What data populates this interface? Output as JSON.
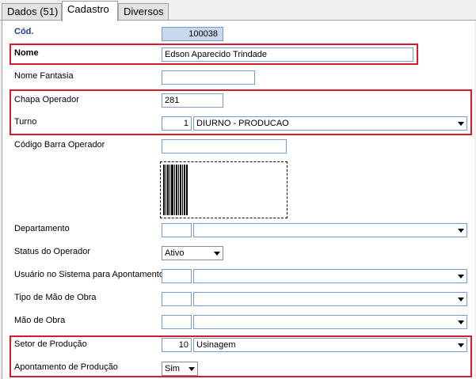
{
  "tabs": [
    {
      "label": "Dados (51)",
      "active": false
    },
    {
      "label": "Cadastro",
      "active": true
    },
    {
      "label": "Diversos",
      "active": false
    }
  ],
  "form": {
    "cod": {
      "label": "Cód.",
      "value": "100038"
    },
    "nome": {
      "label": "Nome",
      "value": "Edson Aparecido Trindade"
    },
    "nome_fantasia": {
      "label": "Nome Fantasia",
      "value": ""
    },
    "chapa_operador": {
      "label": "Chapa Operador",
      "value": "281"
    },
    "turno": {
      "label": "Turno",
      "code": "1",
      "value": "DIURNO - PRODUCAO"
    },
    "codigo_barra": {
      "label": "Código Barra Operador",
      "value": ""
    },
    "departamento": {
      "label": "Departamento",
      "code": "",
      "value": ""
    },
    "status_operador": {
      "label": "Status do Operador",
      "value": "Ativo"
    },
    "usuario_sistema": {
      "label": "Usuário no Sistema para Apontamento",
      "code": "",
      "value": ""
    },
    "tipo_mao_obra": {
      "label": "Tipo de Mão de Obra",
      "code": "",
      "value": ""
    },
    "mao_obra": {
      "label": "Mão de Obra",
      "code": "",
      "value": ""
    },
    "setor_producao": {
      "label": "Setor de Produção",
      "code": "10",
      "value": "Usinagem"
    },
    "apontamento_producao": {
      "label": "Apontamento de Produção",
      "value": "Sim"
    }
  },
  "colors": {
    "highlight": "#d81a2a",
    "readonly_field": "#c8d8ee",
    "field_border": "#7a9cc8",
    "label_blue": "#1f3a93"
  },
  "icons": {
    "combo_arrow": "chevron-down-icon",
    "barcode": "barcode-icon"
  }
}
